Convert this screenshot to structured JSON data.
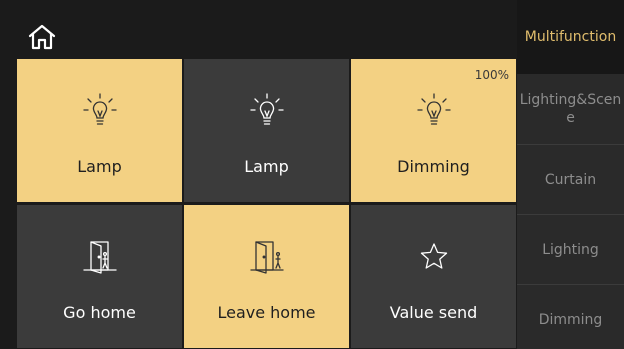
{
  "colors": {
    "background": "#1b1b1b",
    "tile_on": "#f3d183",
    "tile_off": "#3b3b3b",
    "nav_bg": "#2a2a2a",
    "nav_active_text": "#e0bd6d",
    "nav_text": "#8d8d8d"
  },
  "header": {
    "home_icon": "home-icon"
  },
  "tiles": [
    {
      "label": "Lamp",
      "icon": "lightbulb-icon",
      "state": "on",
      "level": ""
    },
    {
      "label": "Lamp",
      "icon": "lightbulb-icon",
      "state": "off",
      "level": ""
    },
    {
      "label": "Dimming",
      "icon": "lightbulb-icon",
      "state": "on",
      "level": "100%"
    },
    {
      "label": "Go home",
      "icon": "door-person-icon",
      "state": "off",
      "level": ""
    },
    {
      "label": "Leave home",
      "icon": "door-person-icon",
      "state": "on",
      "level": ""
    },
    {
      "label": "Value send",
      "icon": "star-icon",
      "state": "off",
      "level": ""
    }
  ],
  "sidebar": {
    "items": [
      {
        "label": "Multifunction",
        "active": true
      },
      {
        "label": "Lighting&Scene",
        "active": false
      },
      {
        "label": "Curtain",
        "active": false
      },
      {
        "label": "Lighting",
        "active": false
      },
      {
        "label": "Dimming",
        "active": false
      }
    ]
  }
}
